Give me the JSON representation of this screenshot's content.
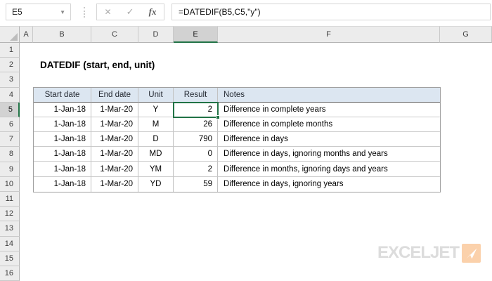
{
  "formula_bar": {
    "name_box": "E5",
    "cancel_icon": "✕",
    "confirm_icon": "✓",
    "fx_label": "fx",
    "formula": "=DATEDIF(B5,C5,\"y\")"
  },
  "sheet": {
    "title": "DATEDIF (start, end, unit)",
    "columns": [
      "A",
      "B",
      "C",
      "D",
      "E",
      "F",
      "G"
    ],
    "rows": [
      "1",
      "2",
      "3",
      "4",
      "5",
      "6",
      "7",
      "8",
      "9",
      "10",
      "11",
      "12",
      "13",
      "14",
      "15",
      "16"
    ],
    "selected_cell": "E5",
    "selected_column": "E",
    "selected_row": "5"
  },
  "table": {
    "headers": [
      "Start date",
      "End date",
      "Unit",
      "Result",
      "Notes"
    ],
    "rows": [
      [
        "1-Jan-18",
        "1-Mar-20",
        "Y",
        "2",
        "Difference in complete years"
      ],
      [
        "1-Jan-18",
        "1-Mar-20",
        "M",
        "26",
        "Difference in complete months"
      ],
      [
        "1-Jan-18",
        "1-Mar-20",
        "D",
        "790",
        "Difference in days"
      ],
      [
        "1-Jan-18",
        "1-Mar-20",
        "MD",
        "0",
        "Difference in days, ignoring months and years"
      ],
      [
        "1-Jan-18",
        "1-Mar-20",
        "YM",
        "2",
        "Difference in months, ignoring days and years"
      ],
      [
        "1-Jan-18",
        "1-Mar-20",
        "YD",
        "59",
        "Difference in days, ignoring years"
      ]
    ]
  },
  "logo": {
    "text": "EXCELJET"
  },
  "colors": {
    "selection_green": "#217346",
    "table_header_fill": "#dce6f1",
    "header_gray": "#ececec",
    "logo_gray": "#dcdcdc",
    "logo_orange": "#fbd1ab"
  }
}
